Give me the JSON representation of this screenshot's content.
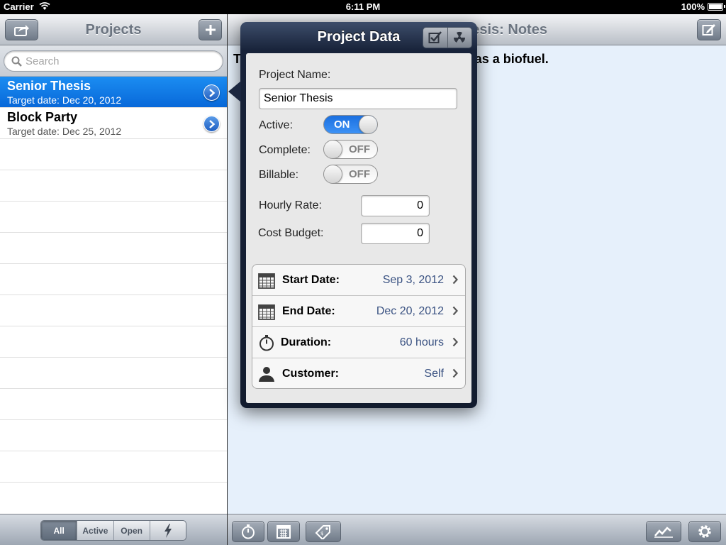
{
  "status_bar": {
    "carrier": "Carrier",
    "time": "6:11 PM",
    "battery": "100%"
  },
  "projects_pane": {
    "title": "Projects",
    "search_placeholder": "Search",
    "items": [
      {
        "name": "Senior Thesis",
        "subtitle": "Target date: Dec 20, 2012",
        "selected": true
      },
      {
        "name": "Block Party",
        "subtitle": "Target date: Dec 25, 2012",
        "selected": false
      }
    ],
    "filter_segments": [
      {
        "label": "All",
        "selected": true
      },
      {
        "label": "Active",
        "selected": false
      },
      {
        "label": "Open",
        "selected": false
      },
      {
        "icon": "lightning-icon",
        "selected": false
      }
    ]
  },
  "notes_pane": {
    "title": "Senior Thesis: Notes",
    "note_text": "To explore the feasibility of using algae as a biofuel."
  },
  "popover": {
    "title": "Project Data",
    "project_name_label": "Project Name:",
    "project_name_value": "Senior Thesis",
    "toggles": [
      {
        "label": "Active:",
        "state": "ON",
        "on": true
      },
      {
        "label": "Complete:",
        "state": "OFF",
        "on": false
      },
      {
        "label": "Billable:",
        "state": "OFF",
        "on": false
      }
    ],
    "hourly_rate_label": "Hourly Rate:",
    "hourly_rate_value": "0",
    "cost_budget_label": "Cost Budget:",
    "cost_budget_value": "0",
    "details": [
      {
        "icon": "calendar-icon",
        "label": "Start Date:",
        "value": "Sep 3, 2012"
      },
      {
        "icon": "calendar-icon",
        "label": "End Date:",
        "value": "Dec 20, 2012"
      },
      {
        "icon": "stopwatch-icon",
        "label": "Duration:",
        "value": "60 hours"
      },
      {
        "icon": "person-icon",
        "label": "Customer:",
        "value": "Self"
      }
    ]
  },
  "colors": {
    "selection_blue": "#0a6fdc",
    "notes_background": "#e6f0fb",
    "popover_frame": "#18233a",
    "detail_value": "#3a5282"
  }
}
